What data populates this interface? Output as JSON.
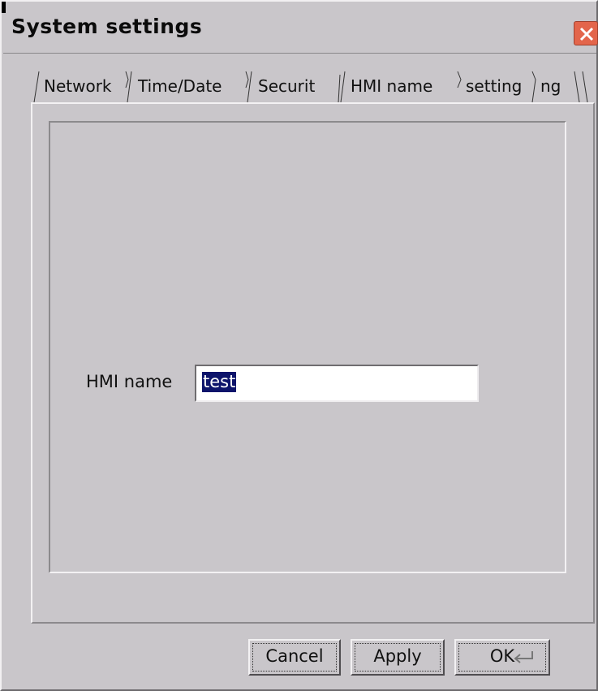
{
  "window": {
    "title": "System settings"
  },
  "tabs": [
    {
      "label": "Network"
    },
    {
      "label": "Time/Date"
    },
    {
      "label": "Securit"
    },
    {
      "label": "HMI name"
    },
    {
      "label": "setting"
    },
    {
      "label": "ng"
    }
  ],
  "active_tab": "HMI name",
  "form": {
    "hmi_name_label": "HMI name",
    "hmi_name_value": "test"
  },
  "buttons": {
    "cancel": "Cancel",
    "apply": "Apply",
    "ok": "OK"
  },
  "icons": {
    "close": "close-icon",
    "enter": "enter-icon"
  },
  "colors": {
    "background": "#c9c6ca",
    "selection": "#0d146b",
    "close_button": "#e3654b"
  }
}
